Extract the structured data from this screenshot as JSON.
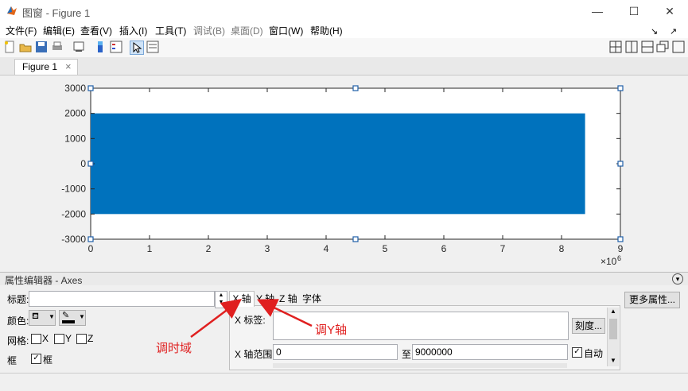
{
  "window": {
    "title": "图窗 - Figure 1",
    "minimize": "—",
    "maximize": "☐",
    "close": "✕"
  },
  "menu": [
    "文件(F)",
    "编辑(E)",
    "查看(V)",
    "插入(I)",
    "工具(T)",
    "调试(B)",
    "桌面(D)",
    "窗口(W)",
    "帮助(H)"
  ],
  "menu_disabled": [
    "调试(B)",
    "桌面(D)"
  ],
  "tabs": {
    "figure_tab": "Figure 1",
    "close": "×"
  },
  "chart_data": {
    "type": "area",
    "x_range": [
      0,
      8400000
    ],
    "y_range": [
      -2000,
      2000
    ],
    "xlim": [
      0,
      9000000
    ],
    "ylim": [
      -3000,
      3000
    ],
    "xticks": [
      "0",
      "1",
      "2",
      "3",
      "4",
      "5",
      "6",
      "7",
      "8",
      "9"
    ],
    "yticks": [
      "3000",
      "2000",
      "1000",
      "0",
      "-1000",
      "-2000",
      "-3000"
    ],
    "x_exponent": "×10",
    "x_exponent_power": "6",
    "fill_color": "#0072bd",
    "grid": false
  },
  "prop_editor": {
    "header": "属性编辑器 - Axes",
    "title_label": "标题:",
    "title_value": "",
    "color_label": "颜色:",
    "grid_label": "网格:",
    "grid_x": "X",
    "grid_y": "Y",
    "grid_z": "Z",
    "box_label": "框",
    "box_check_label": "框",
    "tabs": [
      "X 轴",
      "Y 轴",
      "Z 轴",
      "字体"
    ],
    "x_label_label": "X 标签:",
    "ticks_button": "刻度...",
    "x_range_label": "X 轴范围:",
    "x_min": "0",
    "to": "至",
    "x_max": "9000000",
    "auto_label": "自动",
    "more_props": "更多属性..."
  },
  "annotations": {
    "time_domain": "调时域",
    "y_axis": "调Y轴"
  }
}
